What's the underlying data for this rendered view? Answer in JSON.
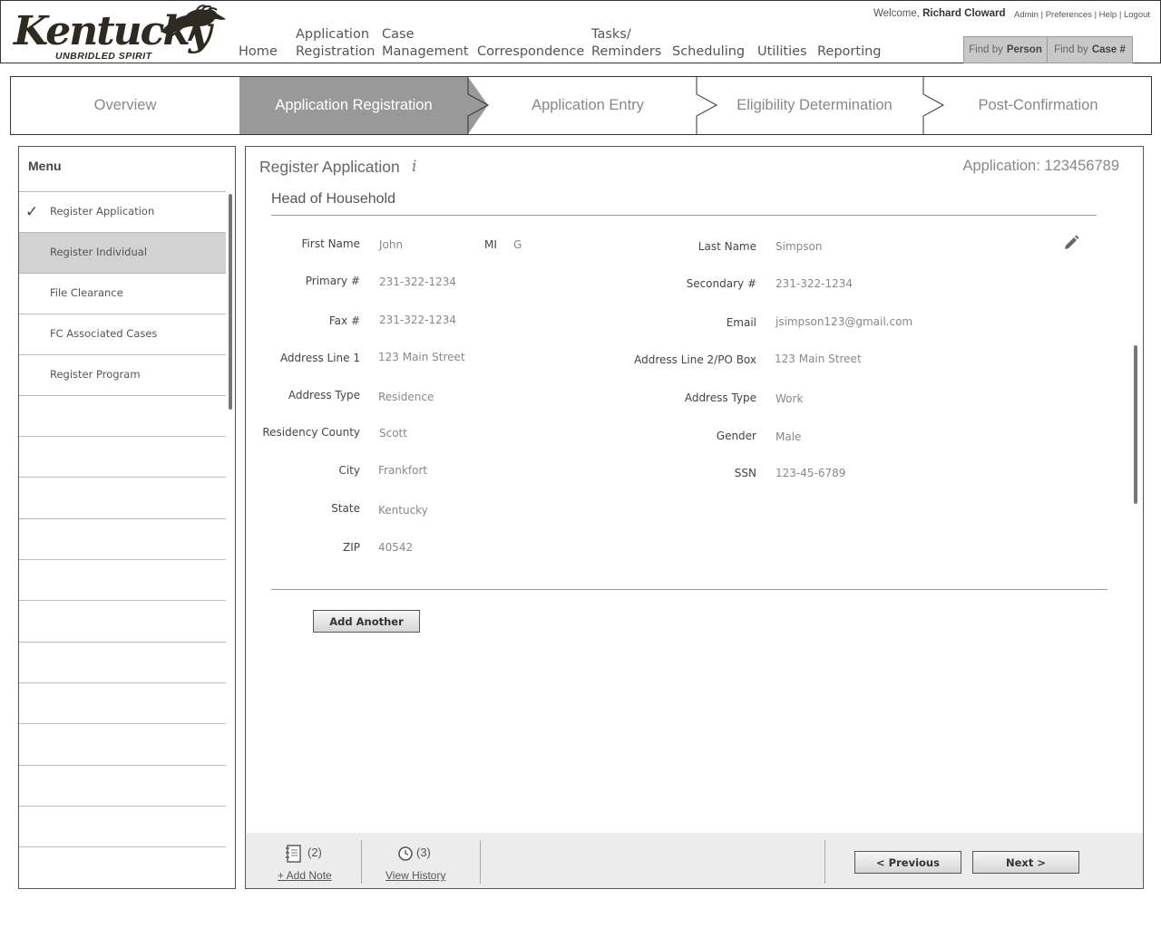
{
  "header": {
    "logo": {
      "word": "Kentucky",
      "tagline": "UNBRIDLED SPIRIT",
      "trademark": "™"
    },
    "nav": [
      {
        "id": "home",
        "line1": "",
        "line2": "Home"
      },
      {
        "id": "application-registration",
        "line1": "Application",
        "line2": "Registration"
      },
      {
        "id": "case-management",
        "line1": "Case",
        "line2": "Management"
      },
      {
        "id": "correspondence",
        "line1": "",
        "line2": "Correspondence"
      },
      {
        "id": "tasks-reminders",
        "line1": "Tasks/",
        "line2": "Reminders"
      },
      {
        "id": "scheduling",
        "line1": "",
        "line2": "Scheduling"
      },
      {
        "id": "utilities",
        "line1": "",
        "line2": "Utilities"
      },
      {
        "id": "reporting",
        "line1": "",
        "line2": "Reporting"
      }
    ],
    "welcome_prefix": "Welcome,",
    "user_name": "Richard Cloward",
    "links": {
      "admin": "Admin",
      "preferences": "Preferences",
      "help": "Help",
      "logout": "Logout",
      "separator": "|"
    },
    "find_person": {
      "prefix": "Find by",
      "target": "Person"
    },
    "find_case": {
      "prefix": "Find by",
      "target": "Case #"
    }
  },
  "stepper": {
    "steps": [
      "Overview",
      "Application Registration",
      "Application Entry",
      "Eligibility Determination",
      "Post-Confirmation"
    ],
    "active_index": 1,
    "active_color": "#999999"
  },
  "menu": {
    "title": "Menu",
    "items": [
      "Register Application",
      "Register Individual",
      "File Clearance",
      "FC Associated Cases",
      "Register Program"
    ],
    "completed_item": "Register Application",
    "check_glyph": "✓",
    "selected_item": "Register Individual",
    "empty_row_count": 11
  },
  "main": {
    "title": "Register Application",
    "info_glyph": "i",
    "application_label": "Application:",
    "application_number": "123456789",
    "section_title": "Head of Household",
    "fields": {
      "first_name": {
        "label": "First Name",
        "value": "John"
      },
      "mi": {
        "label": "MI",
        "value": "G"
      },
      "last_name": {
        "label": "Last Name",
        "value": "Simpson"
      },
      "primary": {
        "label": "Primary #",
        "value": "231-322-1234"
      },
      "secondary": {
        "label": "Secondary #",
        "value": "231-322-1234"
      },
      "fax": {
        "label": "Fax #",
        "value": "231-322-1234"
      },
      "email": {
        "label": "Email",
        "value": "jsimpson123@gmail.com"
      },
      "address1": {
        "label": "Address Line 1",
        "value": "123 Main Street"
      },
      "address2": {
        "label": "Address Line 2/PO Box",
        "value": "123 Main Street"
      },
      "address_type_left": {
        "label": "Address Type",
        "value": "Residence"
      },
      "address_type_right": {
        "label": "Address Type",
        "value": "Work"
      },
      "residency_county": {
        "label": "Residency County",
        "value": "Scott"
      },
      "gender": {
        "label": "Gender",
        "value": "Male"
      },
      "city": {
        "label": "City",
        "value": "Frankfort"
      },
      "ssn": {
        "label": "SSN",
        "value": "123-45-6789"
      },
      "state": {
        "label": "State",
        "value": "Kentucky"
      },
      "zip": {
        "label": "ZIP",
        "value": "40542"
      }
    },
    "add_another": "Add Another",
    "edit_icon": "pencil-icon"
  },
  "footer": {
    "notes_count": "(2)",
    "add_note": "+ Add Note",
    "history_count": "(3)",
    "view_history": "View History",
    "previous": "< Previous",
    "next": "Next >",
    "icons": {
      "notes": "notebook-icon",
      "history": "clock-icon"
    }
  }
}
